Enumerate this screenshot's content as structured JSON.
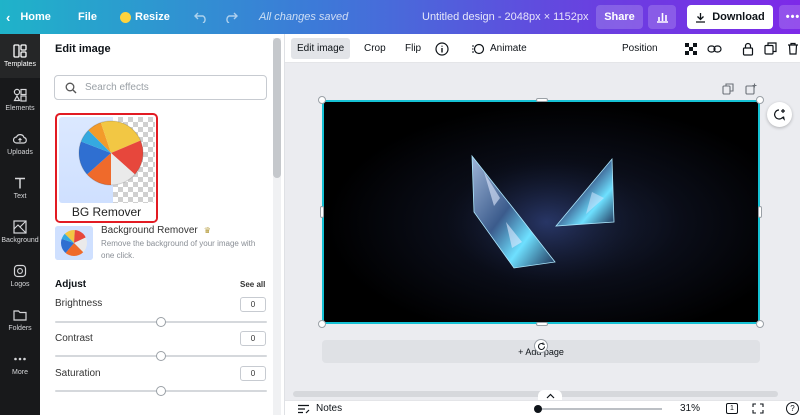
{
  "topbar": {
    "home": "Home",
    "file": "File",
    "resize": "Resize",
    "save_status": "All changes saved",
    "doc_title": "Untitled design - 2048px × 1152px",
    "share": "Share",
    "download": "Download",
    "more": "•••"
  },
  "rail": {
    "items": [
      {
        "label": "Templates",
        "icon": "templates-icon"
      },
      {
        "label": "Elements",
        "icon": "elements-icon"
      },
      {
        "label": "Uploads",
        "icon": "uploads-icon"
      },
      {
        "label": "Text",
        "icon": "text-icon"
      },
      {
        "label": "Background",
        "icon": "background-icon"
      },
      {
        "label": "Logos",
        "icon": "logos-icon"
      },
      {
        "label": "Folders",
        "icon": "folders-icon"
      },
      {
        "label": "More",
        "icon": "more-icon"
      }
    ]
  },
  "panel": {
    "title": "Edit image",
    "search_placeholder": "Search effects",
    "bg_remover_label": "BG Remover",
    "bg_remover_title": "Background Remover",
    "bg_remover_desc": "Remove the background of your image with one click.",
    "adjust": "Adjust",
    "see_all": "See all",
    "adjustments": [
      {
        "label": "Brightness",
        "value": "0"
      },
      {
        "label": "Contrast",
        "value": "0"
      },
      {
        "label": "Saturation",
        "value": "0"
      }
    ]
  },
  "ctx": {
    "edit_image": "Edit image",
    "crop": "Crop",
    "flip": "Flip",
    "animate": "Animate",
    "position": "Position"
  },
  "canvas": {
    "add_page": "+ Add page"
  },
  "bottom": {
    "notes": "Notes",
    "zoom": "31%",
    "page_num": "1",
    "help": "?"
  },
  "colors": {
    "selection": "#15c1d4",
    "highlight": "#e21b23",
    "accent_gradient_start": "#1fb3c9",
    "accent_gradient_end": "#7d2ae8"
  }
}
